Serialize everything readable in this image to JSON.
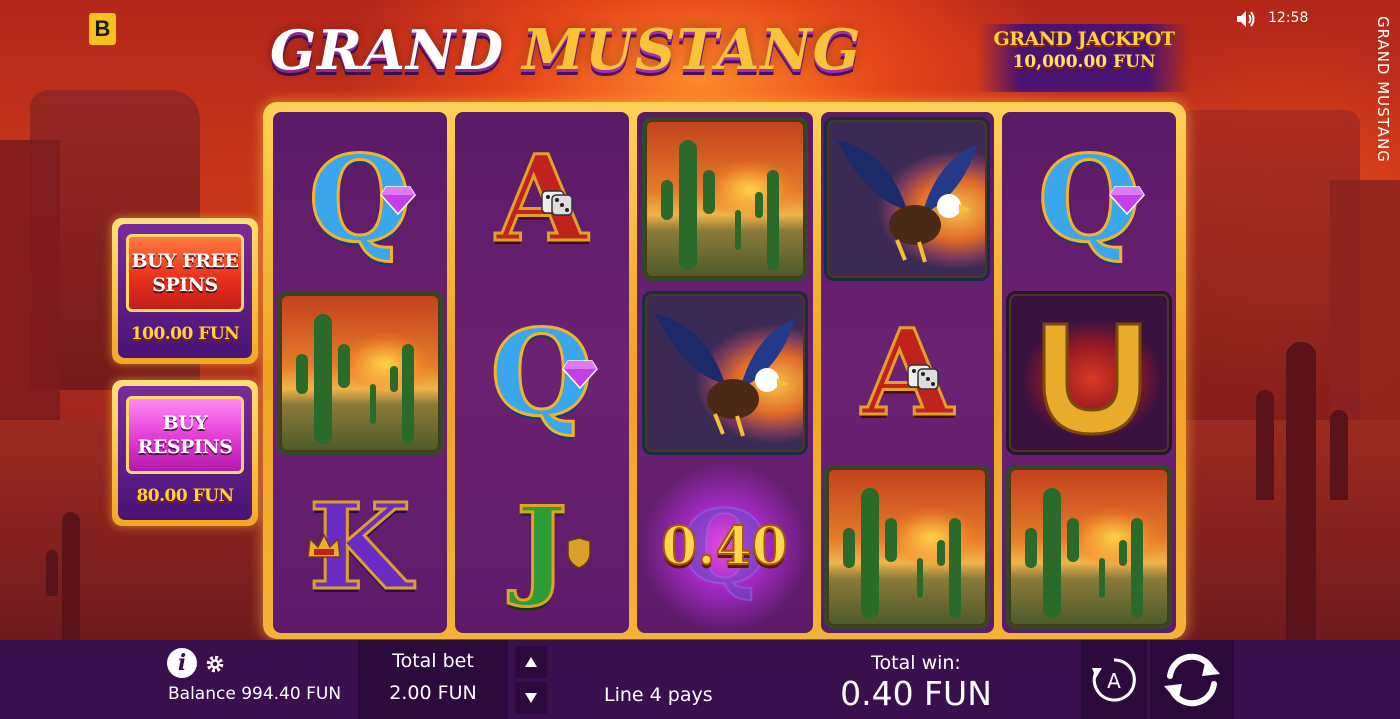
{
  "brand": {
    "logo_letter": "B"
  },
  "status": {
    "clock": "12:58",
    "sound_icon": "speaker-icon"
  },
  "game": {
    "title_part1": "GRAND",
    "title_part2": "MUSTANG",
    "side_title": "GRAND MUSTANG"
  },
  "jackpot": {
    "label": "GRAND JACKPOT",
    "value": "10,000.00 FUN"
  },
  "buy_features": [
    {
      "label_line1": "BUY FREE",
      "label_line2": "SPINS",
      "price": "100.00 FUN",
      "color": "#e8321c"
    },
    {
      "label_line1": "BUY",
      "label_line2": "RESPINS",
      "price": "80.00 FUN",
      "color": "#e23ad6"
    }
  ],
  "reels": [
    [
      "Q-diamond",
      "cactus",
      "K-crown"
    ],
    [
      "A-dice",
      "Q-diamond",
      "J-shield"
    ],
    [
      "cactus",
      "eagle",
      "win-0.40"
    ],
    [
      "eagle",
      "A-dice",
      "cactus"
    ],
    [
      "Q-diamond",
      "horseshoe",
      "cactus"
    ]
  ],
  "reel_symbols": {
    "q": "Q",
    "a": "A",
    "k": "K",
    "j": "J"
  },
  "win_badge": {
    "value": "0.40"
  },
  "bottom": {
    "balance": "Balance 994.40 FUN",
    "total_bet_label": "Total bet",
    "total_bet_value": "2.00 FUN",
    "line_pays": "Line 4 pays",
    "total_win_label": "Total win:",
    "total_win_value": "0.40 FUN",
    "info_glyph": "i",
    "auto_glyph": "A"
  },
  "colors": {
    "accent_gold": "#f6c33a",
    "bar": "#3a0f4e",
    "reel_bg": "#6c2272"
  }
}
